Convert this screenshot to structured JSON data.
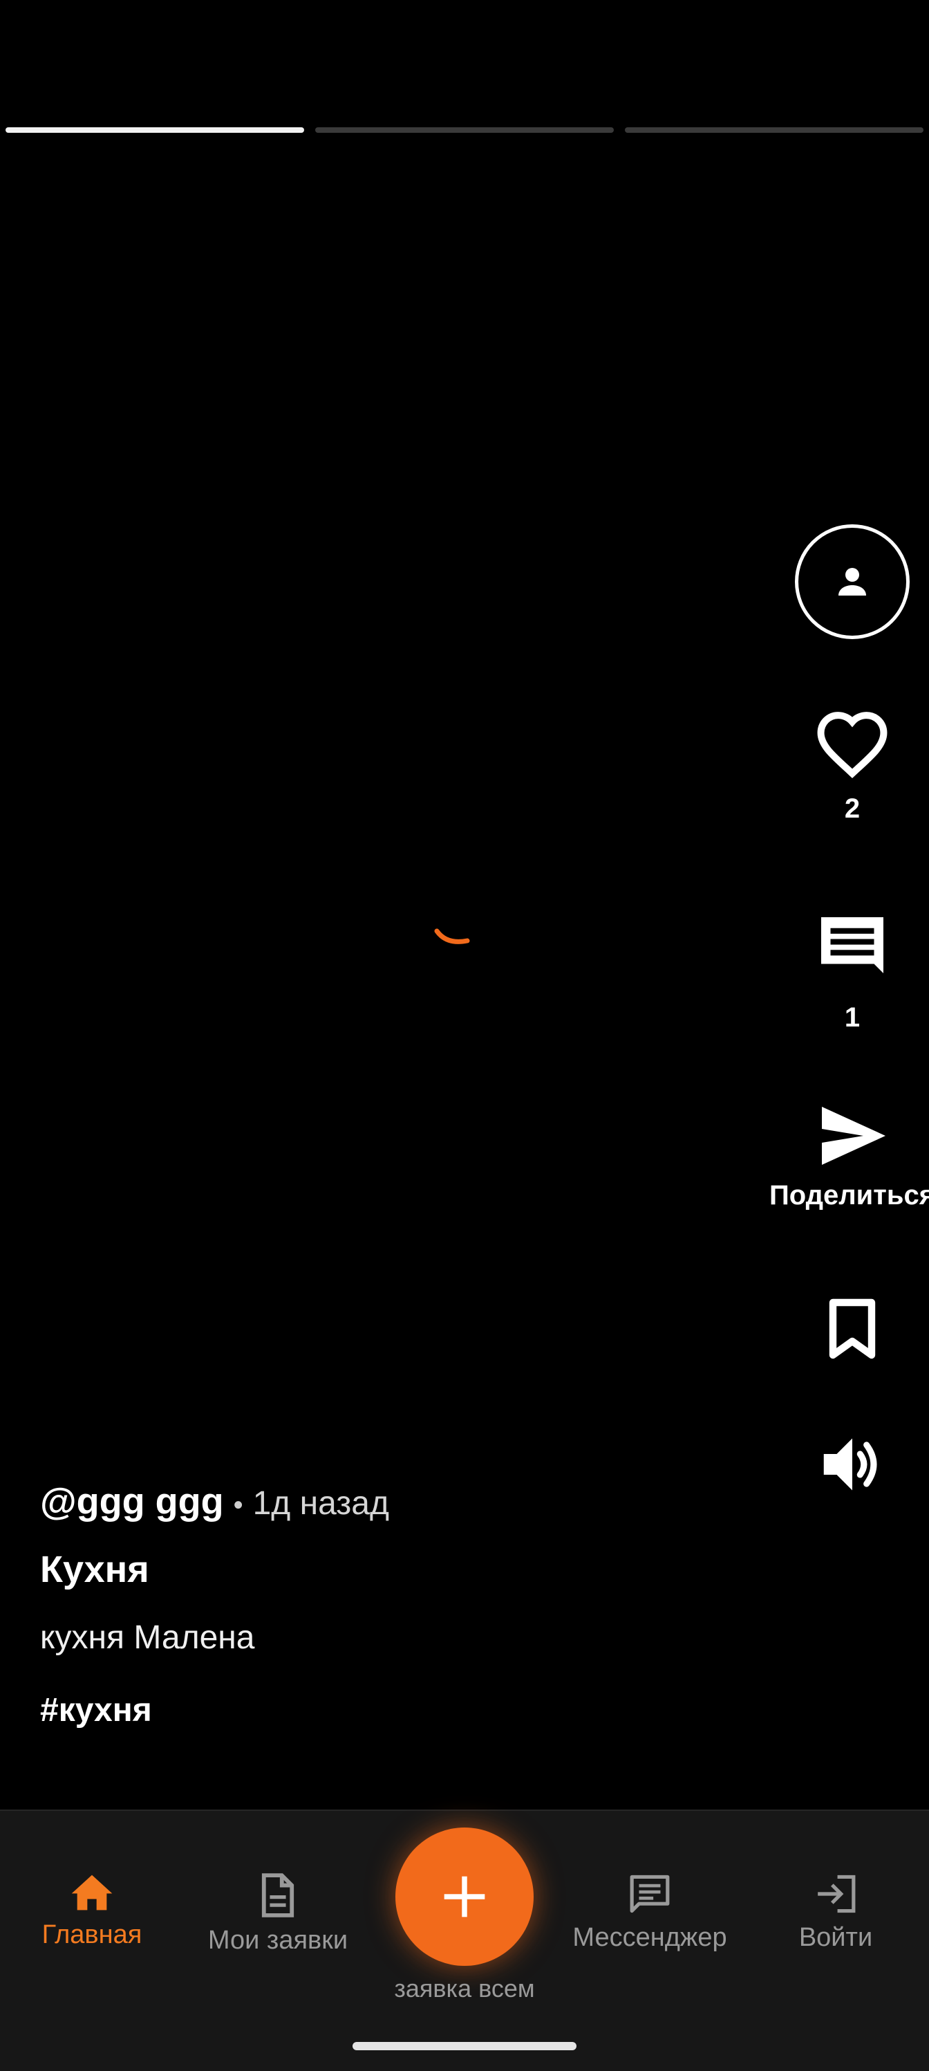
{
  "stories": {
    "count": 3,
    "active_index": 0
  },
  "actions": {
    "like_count": "2",
    "comment_count": "1",
    "share_label": "Поделиться"
  },
  "post": {
    "author": "@ggg ggg",
    "separator": "•",
    "time": "1д назад",
    "title": "Кухня",
    "description": "кухня Малена",
    "tag": "#кухня"
  },
  "nav": {
    "home": "Главная",
    "my_requests": "Мои заявки",
    "fab_label": "заявка всем",
    "messenger": "Мессенджер",
    "login": "Войти"
  },
  "colors": {
    "accent": "#f26a1b",
    "active_nav": "#f47b20",
    "nav_bg": "#171717"
  }
}
